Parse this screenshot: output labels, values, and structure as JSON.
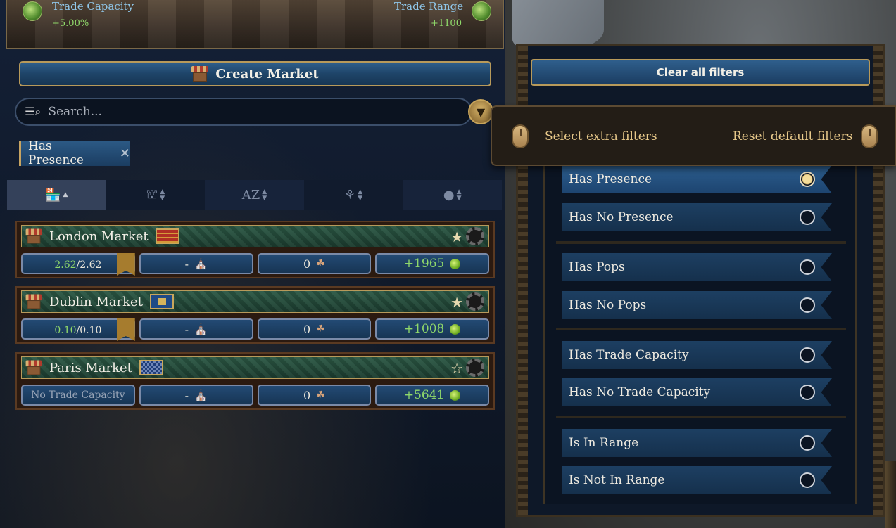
{
  "header": {
    "trade_capacity_label": "Trade Capacity",
    "trade_capacity_value": "+5.00%",
    "trade_range_label": "Trade Range",
    "trade_range_value": "+1100"
  },
  "create_market_label": "Create Market",
  "search": {
    "placeholder": "Search..."
  },
  "active_filter": {
    "label": "Has Presence",
    "close_glyph": "✕"
  },
  "sort_columns": [
    {
      "icon": "market-stall-icon",
      "direction": "asc",
      "active": true
    },
    {
      "icon": "market-owner-icon",
      "direction": "both",
      "active": false
    },
    {
      "icon": "alphabet-sort-icon",
      "direction": "both",
      "active": false
    },
    {
      "icon": "pops-sort-icon",
      "direction": "both",
      "active": false
    },
    {
      "icon": "coin-sort-icon",
      "direction": "both",
      "active": false
    }
  ],
  "markets": [
    {
      "name": "London Market",
      "flag": "england",
      "starred": true,
      "capacity_current": "2.62",
      "capacity_max": "2.62",
      "no_capacity_text": "",
      "buildings": "-",
      "pops": "0",
      "value": "+1965"
    },
    {
      "name": "Dublin Market",
      "flag": "ireland",
      "starred": true,
      "capacity_current": "0.10",
      "capacity_max": "0.10",
      "no_capacity_text": "",
      "buildings": "-",
      "pops": "0",
      "value": "+1008"
    },
    {
      "name": "Paris Market",
      "flag": "france",
      "starred": false,
      "capacity_current": "",
      "capacity_max": "",
      "no_capacity_text": "No Trade Capacity",
      "buildings": "-",
      "pops": "0",
      "value": "+5641"
    }
  ],
  "filter_panel": {
    "clear_all_label": "Clear all filters",
    "tooltip": {
      "left_text": "Select extra filters",
      "right_text": "Reset default filters"
    },
    "groups": [
      [
        {
          "label": "Has Presence",
          "selected": true
        },
        {
          "label": "Has No Presence",
          "selected": false
        }
      ],
      [
        {
          "label": "Has Pops",
          "selected": false
        },
        {
          "label": "Has No Pops",
          "selected": false
        }
      ],
      [
        {
          "label": "Has Trade Capacity",
          "selected": false
        },
        {
          "label": "Has No Trade Capacity",
          "selected": false
        }
      ],
      [
        {
          "label": "Is In Range",
          "selected": false
        },
        {
          "label": "Is Not In Range",
          "selected": false
        }
      ]
    ]
  },
  "colors": {
    "accent_gold": "#b89a5a",
    "positive_green": "#8fd86a",
    "button_blue": "#1e4468"
  }
}
